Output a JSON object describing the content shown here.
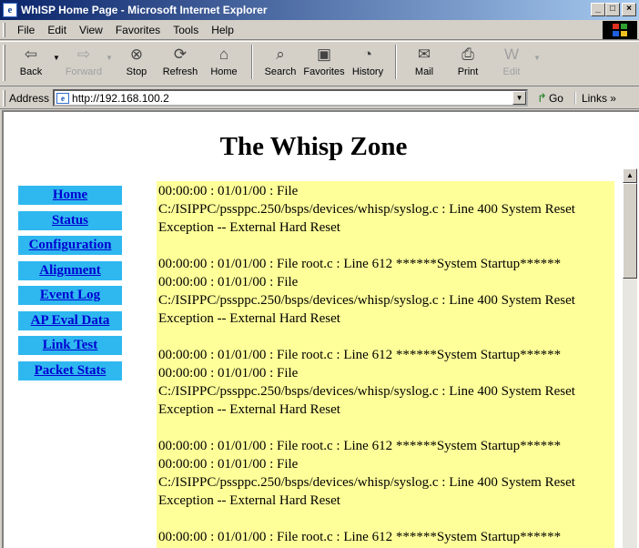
{
  "window": {
    "title": "WhISP Home Page - Microsoft Internet Explorer",
    "controls": [
      "_",
      "□",
      "×"
    ]
  },
  "menu": [
    "File",
    "Edit",
    "View",
    "Favorites",
    "Tools",
    "Help"
  ],
  "toolbar": {
    "back": "Back",
    "forward": "Forward",
    "stop": "Stop",
    "refresh": "Refresh",
    "home": "Home",
    "search": "Search",
    "favorites": "Favorites",
    "history": "History",
    "mail": "Mail",
    "print": "Print",
    "edit": "Edit"
  },
  "address": {
    "label": "Address",
    "url": "http://192.168.100.2",
    "go": "Go",
    "links": "Links »"
  },
  "page": {
    "title": "The Whisp Zone",
    "nav": [
      "Home",
      "Status",
      "Configuration",
      "Alignment",
      "Event Log",
      "AP Eval Data",
      "Link Test",
      "Packet Stats"
    ],
    "log": [
      "00:00:00 : 01/01/00 : File\nC:/ISIPPC/pssppc.250/bsps/devices/whisp/syslog.c : Line 400 System Reset\nException -- External Hard Reset",
      "00:00:00 : 01/01/00 : File root.c : Line 612 ******System Startup******\n00:00:00 : 01/01/00 : File\nC:/ISIPPC/pssppc.250/bsps/devices/whisp/syslog.c : Line 400 System Reset\nException -- External Hard Reset",
      "00:00:00 : 01/01/00 : File root.c : Line 612 ******System Startup******\n00:00:00 : 01/01/00 : File\nC:/ISIPPC/pssppc.250/bsps/devices/whisp/syslog.c : Line 400 System Reset\nException -- External Hard Reset",
      "00:00:00 : 01/01/00 : File root.c : Line 612 ******System Startup******\n00:00:00 : 01/01/00 : File\nC:/ISIPPC/pssppc.250/bsps/devices/whisp/syslog.c : Line 400 System Reset\nException -- External Hard Reset",
      "00:00:00 : 01/01/00 : File root.c : Line 612 ******System Startup******"
    ]
  },
  "colors": {
    "nav_background": "#2fb8f0",
    "nav_link": "#0000d0",
    "log_background": "#ffff99",
    "titlebar_start": "#0a246a"
  }
}
